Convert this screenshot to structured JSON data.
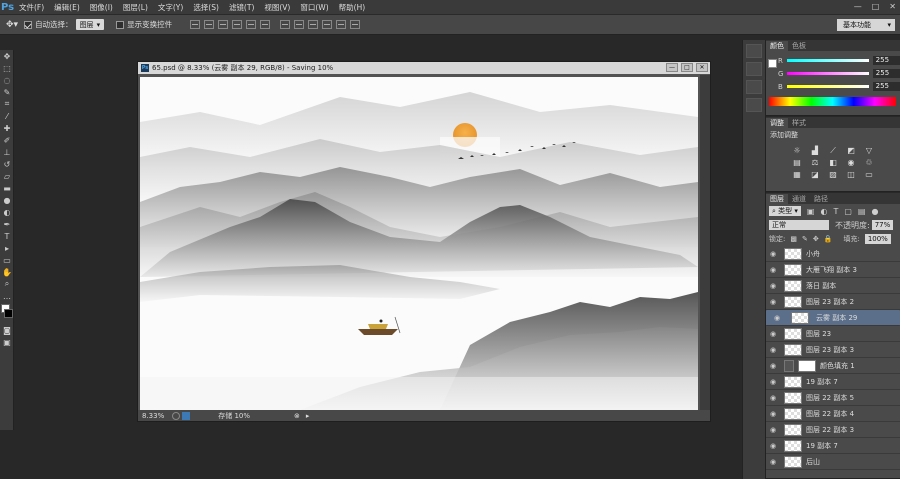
{
  "app": {
    "logo": "Ps"
  },
  "menu": [
    "文件(F)",
    "编辑(E)",
    "图像(I)",
    "图层(L)",
    "文字(Y)",
    "选择(S)",
    "滤镜(T)",
    "视图(V)",
    "窗口(W)",
    "帮助(H)"
  ],
  "window_controls": {
    "minimize": "—",
    "maximize": "□",
    "close": "✕"
  },
  "options": {
    "auto_select_label": "自动选择：",
    "auto_select_value": "图层",
    "show_transform_label": "显示变换控件"
  },
  "workspace": "基本功能",
  "document": {
    "title": "65.psd @ 8.33% (云雾 副本 29, RGB/8) - Saving 10%",
    "zoom": "8.33%",
    "status": "存储 10%"
  },
  "color_panel": {
    "tabs": [
      "颜色",
      "色板"
    ],
    "channels": [
      {
        "label": "R",
        "value": "255"
      },
      {
        "label": "G",
        "value": "255"
      },
      {
        "label": "B",
        "value": "255"
      }
    ]
  },
  "adjust_panel": {
    "tabs": [
      "调整",
      "样式"
    ],
    "heading": "添加调整"
  },
  "layers_panel": {
    "tabs": [
      "图层",
      "通道",
      "路径"
    ],
    "filter": "类型",
    "blend_mode": "正常",
    "opacity_label": "不透明度:",
    "opacity": "77%",
    "lock_label": "锁定:",
    "fill_label": "填充:",
    "fill": "100%",
    "layers": [
      {
        "name": "小舟",
        "selected": false,
        "thumb": "checker"
      },
      {
        "name": "大雁飞翔 副本 3",
        "selected": false,
        "thumb": "checker"
      },
      {
        "name": "落日 副本",
        "selected": false,
        "thumb": "checker"
      },
      {
        "name": "图层 23 副本 2",
        "selected": false,
        "thumb": "checker"
      },
      {
        "name": "云雾 副本 29",
        "selected": true,
        "thumb": "checker"
      },
      {
        "name": "图层 23",
        "selected": false,
        "thumb": "checker"
      },
      {
        "name": "图层 23 副本 3",
        "selected": false,
        "thumb": "checker"
      },
      {
        "name": "颜色填充 1",
        "selected": false,
        "thumb": "white"
      },
      {
        "name": "19 副本 7",
        "selected": false,
        "thumb": "checker"
      },
      {
        "name": "图层 22 副本 5",
        "selected": false,
        "thumb": "checker"
      },
      {
        "name": "图层 22 副本 4",
        "selected": false,
        "thumb": "checker"
      },
      {
        "name": "图层 22 副本 3",
        "selected": false,
        "thumb": "checker"
      },
      {
        "name": "19 副本 7",
        "selected": false,
        "thumb": "checker"
      },
      {
        "name": "后山",
        "selected": false,
        "thumb": "checker"
      }
    ]
  }
}
